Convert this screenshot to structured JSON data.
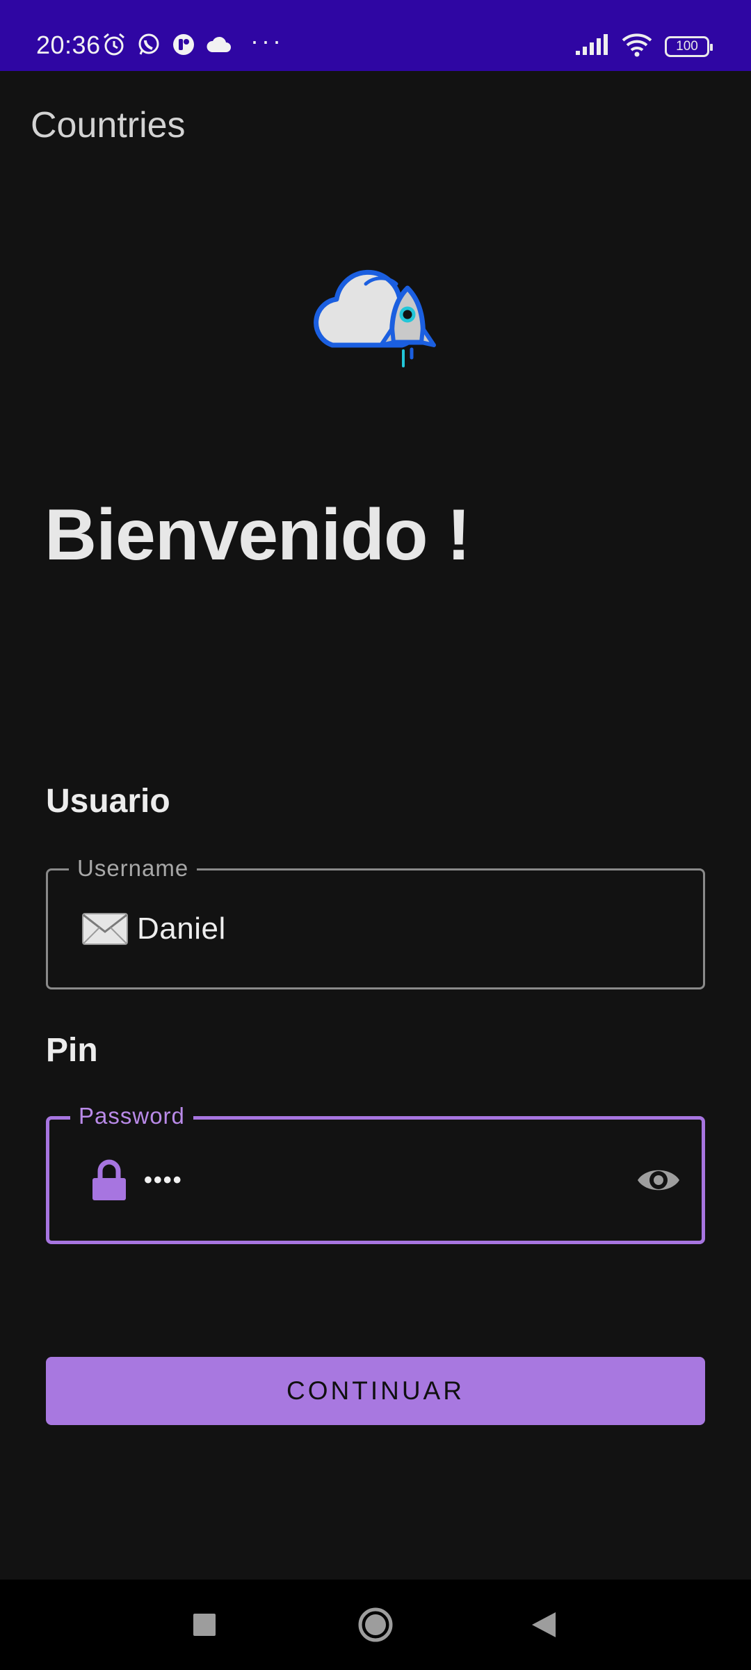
{
  "status_bar": {
    "time": "20:36",
    "left_icons": [
      "alarm-icon",
      "whatsapp-icon",
      "app-icon",
      "cloud-icon"
    ],
    "more": "···",
    "right_icons": [
      "signal-icon",
      "wifi-icon",
      "battery-icon"
    ],
    "battery": "100"
  },
  "app_bar": {
    "title": "Countries"
  },
  "logo": {
    "icon": "cloud-rocket-logo"
  },
  "welcome": {
    "heading": "Bienvenido !"
  },
  "form": {
    "user_section_label": "Usuario",
    "username": {
      "label": "Username",
      "value": "Daniel",
      "icon": "envelope-icon"
    },
    "pin_section_label": "Pin",
    "password": {
      "label": "Password",
      "masked_value": "••••",
      "icon": "lock-icon",
      "toggle_icon": "eye-icon"
    },
    "submit_label": "CONTINUAR"
  },
  "nav_bar": {
    "buttons": [
      "recents",
      "home",
      "back"
    ]
  },
  "colors": {
    "status_bar": "#2f06a3",
    "background": "#121212",
    "accent": "#a878e0",
    "logo_blue": "#1b5fe0",
    "logo_cyan": "#22c6d8"
  }
}
